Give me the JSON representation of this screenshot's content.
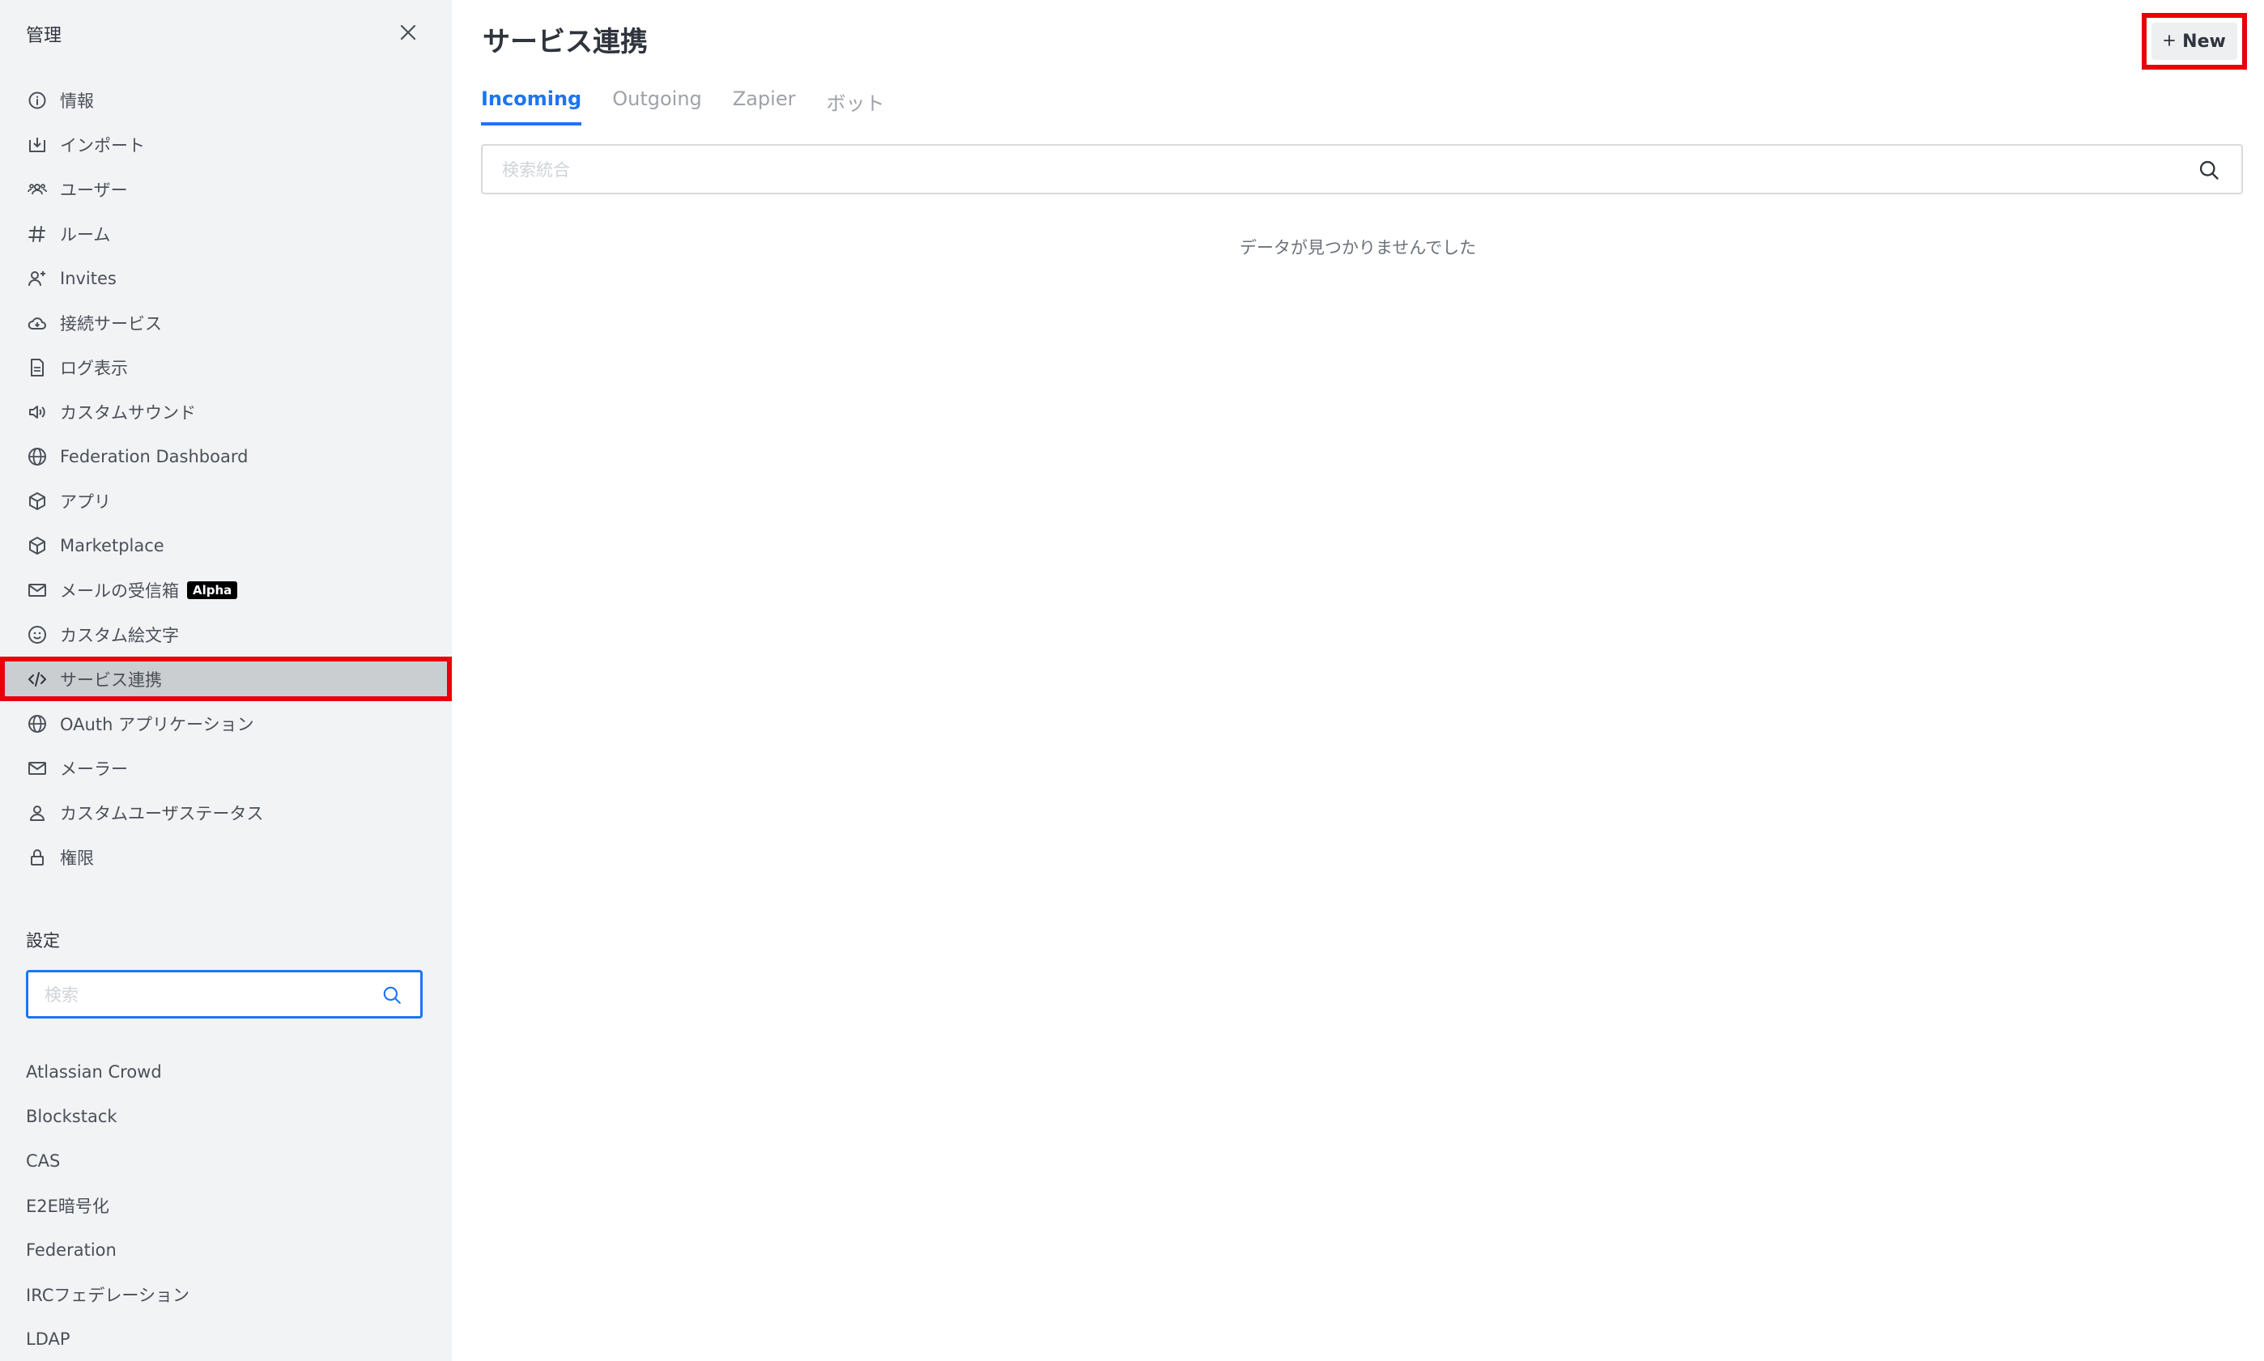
{
  "sidebar": {
    "title": "管理",
    "nav": [
      {
        "label": "情報",
        "icon": "info-icon"
      },
      {
        "label": "インポート",
        "icon": "import-icon"
      },
      {
        "label": "ユーザー",
        "icon": "users-icon"
      },
      {
        "label": "ルーム",
        "icon": "hashtag-icon"
      },
      {
        "label": "Invites",
        "icon": "user-plus-icon"
      },
      {
        "label": "接続サービス",
        "icon": "cloud-icon"
      },
      {
        "label": "ログ表示",
        "icon": "document-icon"
      },
      {
        "label": "カスタムサウンド",
        "icon": "volume-icon"
      },
      {
        "label": "Federation Dashboard",
        "icon": "globe-icon"
      },
      {
        "label": "アプリ",
        "icon": "cube-icon"
      },
      {
        "label": "Marketplace",
        "icon": "cube-icon"
      },
      {
        "label": "メールの受信箱",
        "icon": "mail-icon",
        "badge": "Alpha"
      },
      {
        "label": "カスタム絵文字",
        "icon": "emoji-icon"
      },
      {
        "label": "サービス連携",
        "icon": "code-icon",
        "active": true
      },
      {
        "label": "OAuth アプリケーション",
        "icon": "globe-icon"
      },
      {
        "label": "メーラー",
        "icon": "mail-icon"
      },
      {
        "label": "カスタムユーザステータス",
        "icon": "user-icon"
      },
      {
        "label": "権限",
        "icon": "lock-icon"
      }
    ],
    "settings_title": "設定",
    "settings_search_placeholder": "検索",
    "settings": [
      "Atlassian Crowd",
      "Blockstack",
      "CAS",
      "E2E暗号化",
      "Federation",
      "IRCフェデレーション",
      "LDAP"
    ]
  },
  "main": {
    "title": "サービス連携",
    "new_button": "New",
    "tabs": [
      {
        "label": "Incoming",
        "active": true
      },
      {
        "label": "Outgoing"
      },
      {
        "label": "Zapier"
      },
      {
        "label": "ボット"
      }
    ],
    "search_placeholder": "検索統合",
    "empty_message": "データが見つかりませんでした"
  },
  "colors": {
    "accent": "#1d74f5",
    "highlight": "#e8000b",
    "sidebar_bg": "#f2f3f5",
    "active_bg": "#cbced1"
  }
}
